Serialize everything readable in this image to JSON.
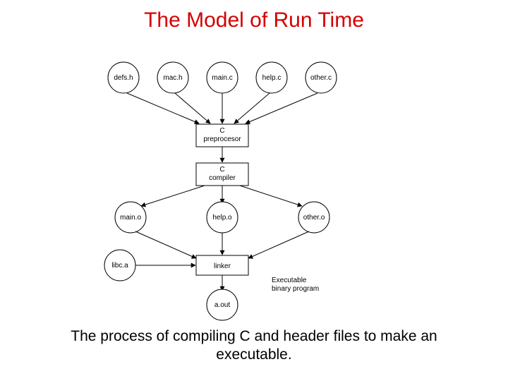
{
  "title": "The Model of Run Time",
  "caption_line1": "The process of compiling C and header files to make an",
  "caption_line2": "executable.",
  "nodes": {
    "defs_h": "defs.h",
    "mac_h": "mac.h",
    "main_c": "main.c",
    "help_c": "help.c",
    "other_c": "other.c",
    "preproc_l1": "C",
    "preproc_l2": "preprocesor",
    "compiler_l1": "C",
    "compiler_l2": "compiler",
    "main_o": "main.o",
    "help_o": "help.o",
    "other_o": "other.o",
    "libc_a": "libc.a",
    "linker": "linker",
    "a_out": "a.out"
  },
  "annotation_l1": "Executable",
  "annotation_l2": "binary program"
}
